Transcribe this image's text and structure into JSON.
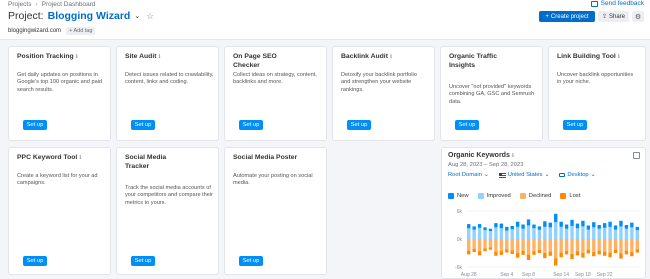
{
  "breadcrumb": [
    "Projects",
    "Project Dashboard"
  ],
  "header": {
    "title_prefix": "Project:",
    "project_name": "Blogging Wizard",
    "domain": "bloggingwizard.com",
    "add_tag": "+ Add tag",
    "send_feedback": "Send feedback",
    "create_project": "Create project",
    "share": "Share"
  },
  "cards": [
    {
      "title": "Position Tracking",
      "desc": "Get daily updates on positions in Google's top 100 organic and paid search results.",
      "button": "Set up"
    },
    {
      "title": "Site Audit",
      "desc": "Detect issues related to crawlability, content, links and coding.",
      "button": "Set up"
    },
    {
      "title": "On Page SEO Checker",
      "desc": "Collect ideas on strategy, content, backlinks and more.",
      "button": "Set up"
    },
    {
      "title": "Backlink Audit",
      "desc": "Detoxify your backlink portfolio and strengthen your website rankings.",
      "button": "Set up"
    },
    {
      "title": "Organic Traffic Insights",
      "desc": "Uncover \"not provided\" keywords combining GA, GSC and Semrush data.",
      "button": "Set up"
    },
    {
      "title": "Link Building Tool",
      "desc": "Uncover backlink opportunities in your niche.",
      "button": "Set up"
    },
    {
      "title": "PPC Keyword Tool",
      "desc": "Create a keyword list for your ad campaigns.",
      "button": "Set up"
    },
    {
      "title": "Social Media Tracker",
      "desc": "Track the social media accounts of your competitors and compare their metrics to yours.",
      "button": "Set up"
    },
    {
      "title": "Social Media Poster",
      "desc": "Automate your posting on social media.",
      "button": "Set up"
    }
  ],
  "organic_keywords": {
    "title": "Organic Keywords",
    "date_range": "Aug 28, 2023 – Sep 28, 2023",
    "filters": {
      "domain": "Root Domain",
      "country": "United States",
      "device": "Desktop"
    },
    "legend": [
      {
        "label": "New",
        "color": "#008ff8"
      },
      {
        "label": "Improved",
        "color": "#8fd1ff"
      },
      {
        "label": "Declined",
        "color": "#ffb266"
      },
      {
        "label": "Lost",
        "color": "#ff8a00"
      }
    ]
  },
  "chart_data": {
    "type": "bar",
    "x": [
      "Aug 28",
      "Aug 29",
      "Aug 30",
      "Aug 31",
      "Sep 1",
      "Sep 2",
      "Sep 3",
      "Sep 4",
      "Sep 5",
      "Sep 6",
      "Sep 7",
      "Sep 8",
      "Sep 9",
      "Sep 10",
      "Sep 11",
      "Sep 12",
      "Sep 13",
      "Sep 14",
      "Sep 15",
      "Sep 16",
      "Sep 17",
      "Sep 18",
      "Sep 19",
      "Sep 20",
      "Sep 21",
      "Sep 22",
      "Sep 23",
      "Sep 24",
      "Sep 25",
      "Sep 26",
      "Sep 27",
      "Sep 28"
    ],
    "x_tick_labels": [
      "Aug 28",
      "Sep 4",
      "Sep 8",
      "Sep 14",
      "Sep 18",
      "Sep 22"
    ],
    "y_tick_labels": [
      "6k",
      "0k",
      "-6k"
    ],
    "ylim": [
      -6000,
      6000
    ],
    "series": [
      {
        "name": "New",
        "values": [
          900,
          700,
          800,
          600,
          500,
          900,
          1000,
          800,
          700,
          1100,
          900,
          1300,
          800,
          700,
          1200,
          1000,
          1800,
          1100,
          900,
          1300,
          1000,
          1200,
          900,
          1100,
          800,
          1000,
          1100,
          900,
          1200,
          800,
          1000,
          700
        ]
      },
      {
        "name": "Improved",
        "values": [
          2300,
          2000,
          2400,
          1900,
          1700,
          2500,
          2300,
          1800,
          2100,
          2600,
          2200,
          2900,
          2300,
          2000,
          2600,
          2500,
          3600,
          2600,
          2200,
          2800,
          2300,
          2700,
          2000,
          2500,
          2200,
          2400,
          2600,
          2000,
          2700,
          2200,
          2500,
          1900
        ]
      },
      {
        "name": "Declined",
        "values": [
          -2500,
          -2100,
          -2600,
          -2000,
          -1800,
          -2700,
          -2600,
          -2200,
          -2400,
          -3000,
          -2500,
          -3300,
          -2600,
          -2300,
          -3000,
          -2700,
          -4100,
          -2900,
          -2500,
          -3200,
          -2600,
          -3000,
          -2300,
          -2800,
          -2500,
          -2700,
          -2900,
          -2300,
          -3100,
          -2500,
          -2800,
          -2200
        ]
      },
      {
        "name": "Lost",
        "values": [
          -800,
          -700,
          -900,
          -600,
          -500,
          -900,
          -800,
          -700,
          -800,
          -1000,
          -900,
          -1200,
          -800,
          -700,
          -1100,
          -900,
          -1600,
          -1000,
          -800,
          -1100,
          -900,
          -1000,
          -800,
          -900,
          -800,
          -900,
          -1000,
          -700,
          -1100,
          -800,
          -900,
          -700
        ]
      }
    ]
  }
}
